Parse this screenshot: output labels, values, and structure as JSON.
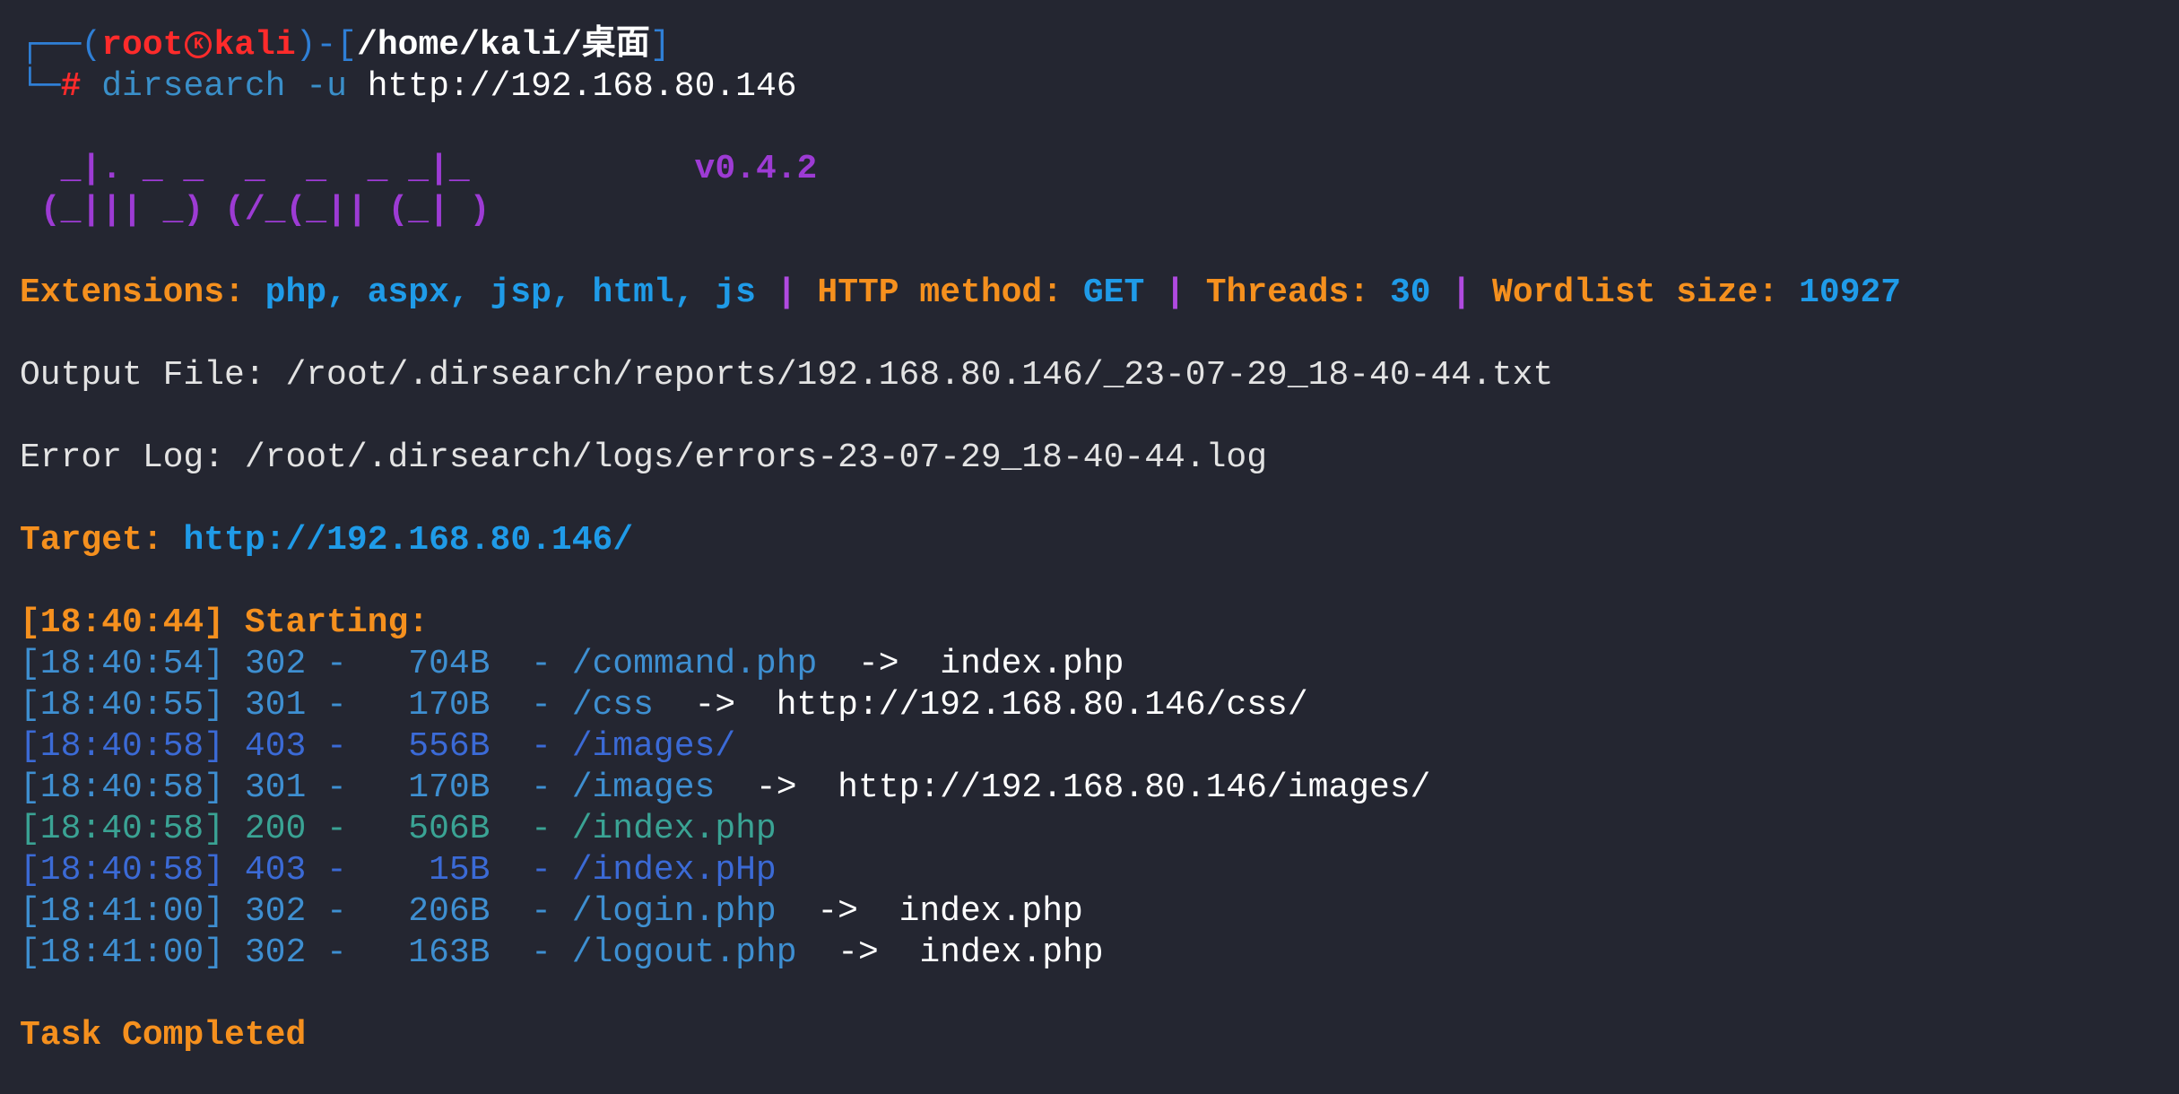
{
  "prompt": {
    "frame_top_left": "┌──(",
    "user": "root",
    "host_icon": "kali-dragon-icon",
    "host": "kali",
    "frame_mid": ")-[",
    "cwd": "/home/kali/桌面",
    "frame_end": "]",
    "frame_bottom_left": "└─",
    "hash": "#",
    "command": "dirsearch",
    "args": "-u",
    "url": "http://192.168.80.146"
  },
  "banner": {
    "art_line1": "  _|. _ _  _  _  _ _|_",
    "art_line2": " (_||| _) (/_(_|| (_| )",
    "version": "v0.4.2"
  },
  "config": {
    "extensions_label": "Extensions:",
    "extensions_value": "php, aspx, jsp, html, js",
    "sep": "|",
    "method_label": "HTTP method:",
    "method_value": "GET",
    "threads_label": "Threads:",
    "threads_value": "30",
    "wordlist_label": "Wordlist size:",
    "wordlist_value": "10927"
  },
  "output_file": "Output File: /root/.dirsearch/reports/192.168.80.146/_23-07-29_18-40-44.txt",
  "error_log": "Error Log: /root/.dirsearch/logs/errors-23-07-29_18-40-44.log",
  "target": {
    "label": "Target:",
    "value": "http://192.168.80.146/"
  },
  "starting": {
    "time": "[18:40:44]",
    "label": "Starting:"
  },
  "results": [
    {
      "text": "[18:40:54] 302 -   704B  - /command.php",
      "arrow": "  ->  ",
      "redirect": "index.php",
      "status": "302"
    },
    {
      "text": "[18:40:55] 301 -   170B  - /css",
      "arrow": "  ->  ",
      "redirect": "http://192.168.80.146/css/",
      "status": "301"
    },
    {
      "text": "[18:40:58] 403 -   556B  - /images/",
      "arrow": "",
      "redirect": "",
      "status": "403"
    },
    {
      "text": "[18:40:58] 301 -   170B  - /images",
      "arrow": "  ->  ",
      "redirect": "http://192.168.80.146/images/",
      "status": "301"
    },
    {
      "text": "[18:40:58] 200 -   506B  - /index.php",
      "arrow": "",
      "redirect": "",
      "status": "200"
    },
    {
      "text": "[18:40:58] 403 -    15B  - /index.pHp",
      "arrow": "",
      "redirect": "",
      "status": "403"
    },
    {
      "text": "[18:41:00] 302 -   206B  - /login.php",
      "arrow": "  ->  ",
      "redirect": "index.php",
      "status": "302"
    },
    {
      "text": "[18:41:00] 302 -   163B  - /logout.php",
      "arrow": "  ->  ",
      "redirect": "index.php",
      "status": "302"
    }
  ],
  "task_completed": "Task Completed",
  "colors": {
    "background": "#242631",
    "orange": "#f5901e",
    "blue": "#1f9be8",
    "purple": "#9d3bd4",
    "red": "#ff2b2b",
    "status_200": "#3aa394",
    "status_30x": "#3e8fd1",
    "status_403": "#3b6ad6"
  }
}
